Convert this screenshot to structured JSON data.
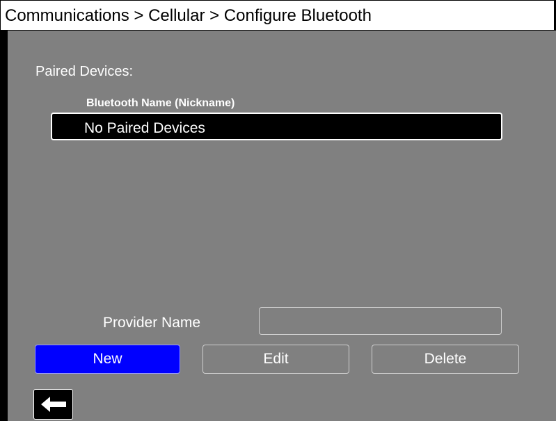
{
  "header": {
    "breadcrumb": "Communications > Cellular > Configure Bluetooth"
  },
  "paired_devices": {
    "section_label": "Paired Devices:",
    "column_header": "Bluetooth Name (Nickname)",
    "items": [
      {
        "label": "No Paired Devices"
      }
    ]
  },
  "provider": {
    "label": "Provider Name",
    "value": "",
    "placeholder": ""
  },
  "actions": {
    "new_label": "New",
    "edit_label": "Edit",
    "delete_label": "Delete"
  },
  "navigation": {
    "back_icon": "left-arrow-icon"
  },
  "colors": {
    "background": "#808080",
    "title_background": "#ffffff",
    "list_background": "#000000",
    "selected_button": "#0000ff",
    "text": "#ffffff"
  }
}
